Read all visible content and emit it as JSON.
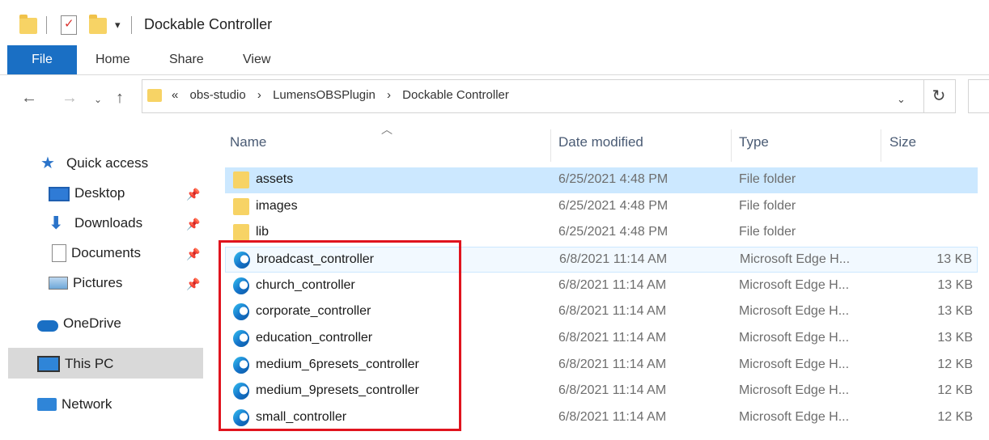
{
  "window": {
    "title": "Dockable Controller"
  },
  "ribbon": {
    "tabs": [
      "File",
      "Home",
      "Share",
      "View"
    ]
  },
  "address": {
    "overflow": "«",
    "crumbs": [
      "obs-studio",
      "LumensOBSPlugin",
      "Dockable Controller"
    ],
    "separator": "›"
  },
  "sidebar": {
    "quick_access": "Quick access",
    "pinned": [
      "Desktop",
      "Downloads",
      "Documents",
      "Pictures"
    ],
    "onedrive": "OneDrive",
    "this_pc": "This PC",
    "network": "Network"
  },
  "columns": {
    "name": "Name",
    "date": "Date modified",
    "type": "Type",
    "size": "Size"
  },
  "files": [
    {
      "name": "assets",
      "date": "6/25/2021 4:48 PM",
      "type": "File folder",
      "size": "",
      "icon": "folder-icon"
    },
    {
      "name": "images",
      "date": "6/25/2021 4:48 PM",
      "type": "File folder",
      "size": "",
      "icon": "folder-icon"
    },
    {
      "name": "lib",
      "date": "6/25/2021 4:48 PM",
      "type": "File folder",
      "size": "",
      "icon": "folder-icon"
    },
    {
      "name": "broadcast_controller",
      "date": "6/8/2021 11:14 AM",
      "type": "Microsoft Edge H...",
      "size": "13 KB",
      "icon": "edge-icon"
    },
    {
      "name": "church_controller",
      "date": "6/8/2021 11:14 AM",
      "type": "Microsoft Edge H...",
      "size": "13 KB",
      "icon": "edge-icon"
    },
    {
      "name": "corporate_controller",
      "date": "6/8/2021 11:14 AM",
      "type": "Microsoft Edge H...",
      "size": "13 KB",
      "icon": "edge-icon"
    },
    {
      "name": "education_controller",
      "date": "6/8/2021 11:14 AM",
      "type": "Microsoft Edge H...",
      "size": "13 KB",
      "icon": "edge-icon"
    },
    {
      "name": "medium_6presets_controller",
      "date": "6/8/2021 11:14 AM",
      "type": "Microsoft Edge H...",
      "size": "12 KB",
      "icon": "edge-icon"
    },
    {
      "name": "medium_9presets_controller",
      "date": "6/8/2021 11:14 AM",
      "type": "Microsoft Edge H...",
      "size": "12 KB",
      "icon": "edge-icon"
    },
    {
      "name": "small_controller",
      "date": "6/8/2021 11:14 AM",
      "type": "Microsoft Edge H...",
      "size": "12 KB",
      "icon": "edge-icon"
    }
  ],
  "colors": {
    "accent": "#1a6fc4",
    "selection": "#cce8ff",
    "highlight_box": "#e0141e"
  }
}
